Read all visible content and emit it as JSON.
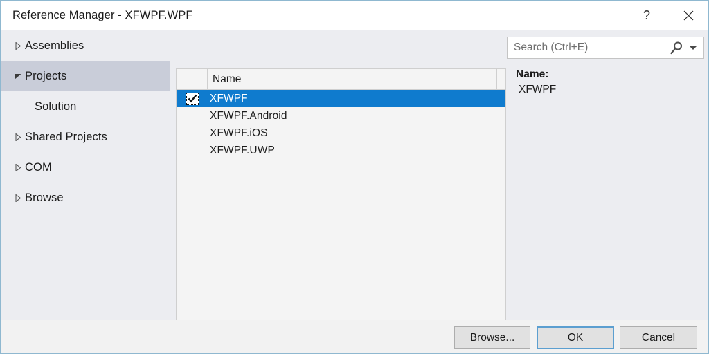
{
  "window": {
    "title": "Reference Manager - XFWPF.WPF",
    "help_icon": "question-mark-icon",
    "close_icon": "close-icon",
    "border_color": "#8FB8D0",
    "background_color": "#ECEDF1"
  },
  "sidebar": {
    "items": [
      {
        "label": "Assemblies",
        "expander": "collapsed",
        "selected": false,
        "child": false
      },
      {
        "label": "Projects",
        "expander": "expanded",
        "selected": true,
        "child": false
      },
      {
        "label": "Solution",
        "expander": "none",
        "selected": false,
        "child": true
      },
      {
        "label": "Shared Projects",
        "expander": "collapsed",
        "selected": false,
        "child": false
      },
      {
        "label": "COM",
        "expander": "collapsed",
        "selected": false,
        "child": false
      },
      {
        "label": "Browse",
        "expander": "collapsed",
        "selected": false,
        "child": false
      }
    ],
    "selected_highlight_color": "#C9CDD9"
  },
  "search": {
    "placeholder": "Search (Ctrl+E)",
    "value": "",
    "icon": "search-icon",
    "dropdown_icon": "chevron-down-icon"
  },
  "list": {
    "columns": [
      "",
      "Name"
    ],
    "name_column_header": "Name",
    "selection_color": "#0F7BCE",
    "rows": [
      {
        "name": "XFWPF",
        "checked": true,
        "selected": true
      },
      {
        "name": "XFWPF.Android",
        "checked": false,
        "selected": false
      },
      {
        "name": "XFWPF.iOS",
        "checked": false,
        "selected": false
      },
      {
        "name": "XFWPF.UWP",
        "checked": false,
        "selected": false
      }
    ]
  },
  "detail": {
    "name_label": "Name:",
    "name_value": "XFWPF"
  },
  "footer": {
    "buttons": [
      {
        "id": "browse",
        "label": "Browse...",
        "accel": "B",
        "default": false
      },
      {
        "id": "ok",
        "label": "OK",
        "accel": "",
        "default": true
      },
      {
        "id": "cancel",
        "label": "Cancel",
        "accel": "",
        "default": false
      }
    ],
    "browse_label_prefix": "",
    "browse_accel": "B",
    "browse_label_suffix": "rowse...",
    "ok_label": "OK",
    "cancel_label": "Cancel"
  }
}
